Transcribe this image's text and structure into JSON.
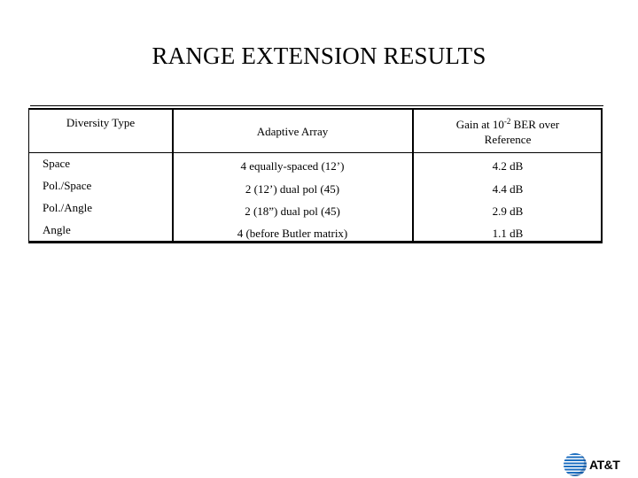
{
  "slide": {
    "title": "RANGE EXTENSION RESULTS"
  },
  "table": {
    "headers": {
      "diversity_type": "Diversity Type",
      "adaptive_array": "Adaptive Array",
      "gain_line1_prefix": "Gain at 10",
      "gain_line1_sup": "-2",
      "gain_line1_suffix": " BER over",
      "gain_line2": "Reference"
    },
    "rows": [
      {
        "diversity_type": "Space",
        "adaptive_array": "4 equally-spaced (12’)",
        "gain": "4.2 dB"
      },
      {
        "diversity_type": "Pol./Space",
        "adaptive_array": "2 (12’) dual pol (45)",
        "gain": "4.4 dB"
      },
      {
        "diversity_type": "Pol./Angle",
        "adaptive_array": "2 (18”) dual pol (45)",
        "gain": "2.9 dB"
      },
      {
        "diversity_type": "Angle",
        "adaptive_array": "4 (before Butler matrix)",
        "gain": "1.1 dB"
      }
    ]
  },
  "logo": {
    "text": "AT&T",
    "icon": "att-globe-icon",
    "color": "#1e6fc0"
  }
}
